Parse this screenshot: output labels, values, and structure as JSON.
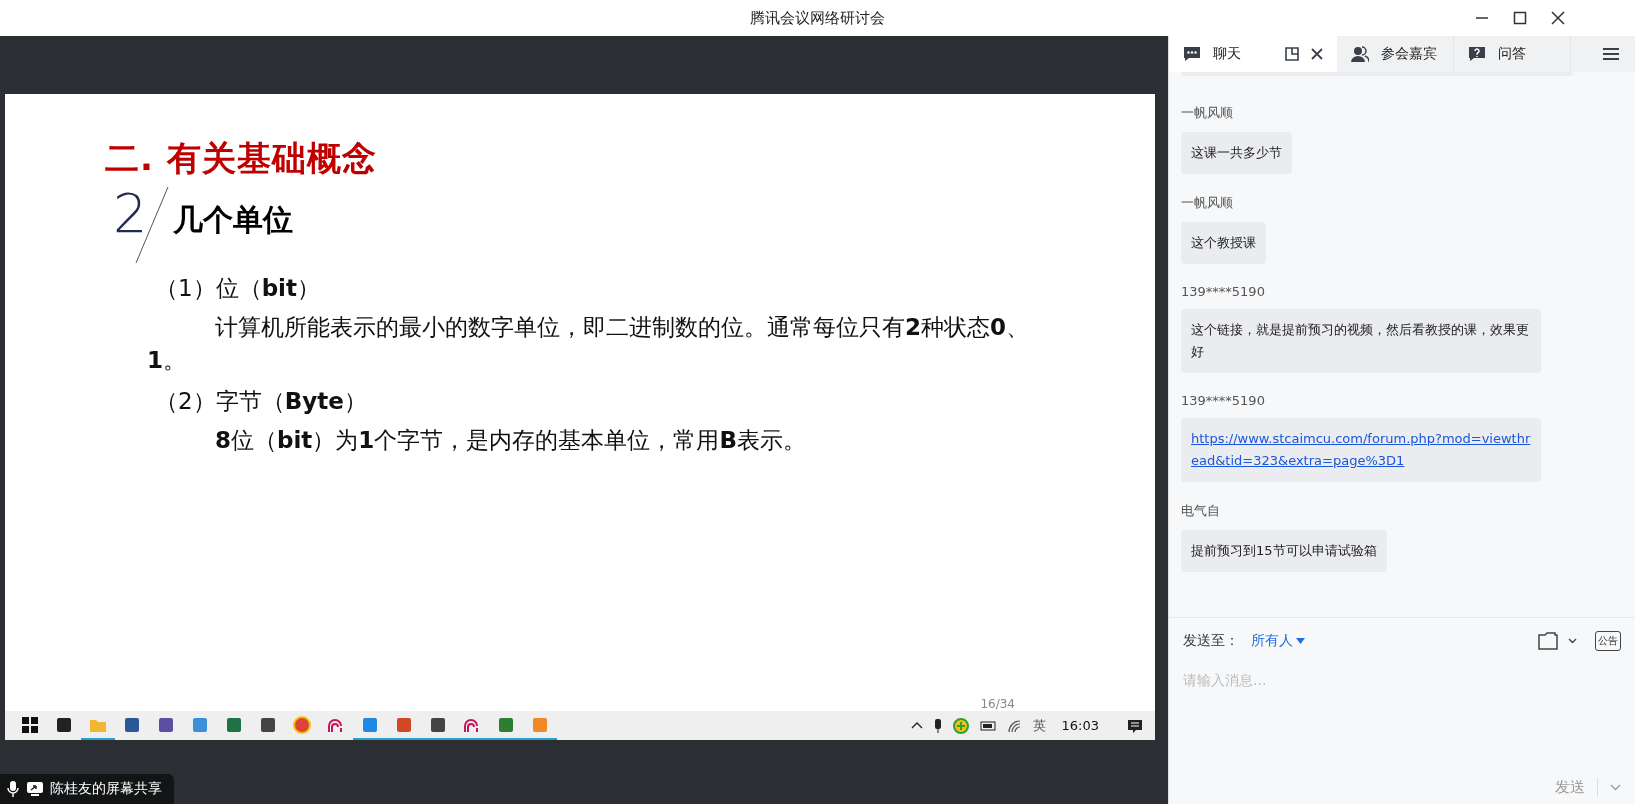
{
  "window": {
    "title": "腾讯会议网络研讨会"
  },
  "slide": {
    "heading": "二. 有关基础概念",
    "section_number": "2",
    "subheading": "几个单位",
    "paragraphs": [
      {
        "kind": "item",
        "text": "（1）位（**bit**）"
      },
      {
        "kind": "body",
        "text": "计算机所能表示的最小的数字单位，即二进制数的位。通常每位只有**2**种状态**0**、**1**。"
      },
      {
        "kind": "item",
        "text": "（2）字节（**Byte**）"
      },
      {
        "kind": "body",
        "text": "**8**位（**bit**）为**1**个字节，是内存的基本单位，常用**B**表示。"
      }
    ],
    "page_number": "16/34"
  },
  "taskbar": {
    "apps": [
      {
        "kind": "windows",
        "running": false
      },
      {
        "kind": "ss",
        "running": false
      },
      {
        "kind": "folder",
        "running": true
      },
      {
        "kind": "word",
        "running": false
      },
      {
        "kind": "building",
        "running": false
      },
      {
        "kind": "window",
        "running": false
      },
      {
        "kind": "excel",
        "running": false
      },
      {
        "kind": "book",
        "running": false
      },
      {
        "kind": "chrome",
        "running": false
      },
      {
        "kind": "wave",
        "running": false
      },
      {
        "kind": "cloud",
        "running": true
      },
      {
        "kind": "ppt",
        "running": true
      },
      {
        "kind": "book",
        "running": true
      },
      {
        "kind": "wave",
        "running": true
      },
      {
        "kind": "sheet",
        "running": true
      },
      {
        "kind": "pdf",
        "running": true
      }
    ],
    "ime": "英",
    "clock": "16:03"
  },
  "share_label": "陈桂友的屏幕共享",
  "panel": {
    "tabs": [
      {
        "label": "聊天",
        "selected": true
      },
      {
        "label": "参会嘉宾",
        "selected": false
      },
      {
        "label": "问答",
        "selected": false
      }
    ],
    "messages": [
      {
        "sender": "一帆风顺",
        "kind": "text",
        "text": "这课一共多少节"
      },
      {
        "sender": "一帆风顺",
        "kind": "text",
        "text": "这个教授课"
      },
      {
        "sender": "139****5190",
        "kind": "text",
        "text": "这个链接，就是提前预习的视频，然后看教授的课，效果更好"
      },
      {
        "sender": "139****5190",
        "kind": "link",
        "text": "https://www.stcaimcu.com/forum.php?mod=viewthread&tid=323&extra=page%3D1"
      },
      {
        "sender": "电气自",
        "kind": "text",
        "text": "提前预习到15节可以申请试验箱"
      }
    ],
    "send_to_label": "发送至：",
    "recipient": "所有人",
    "notice_label": "公告",
    "placeholder": "请输入消息...",
    "send_button": "发送"
  }
}
